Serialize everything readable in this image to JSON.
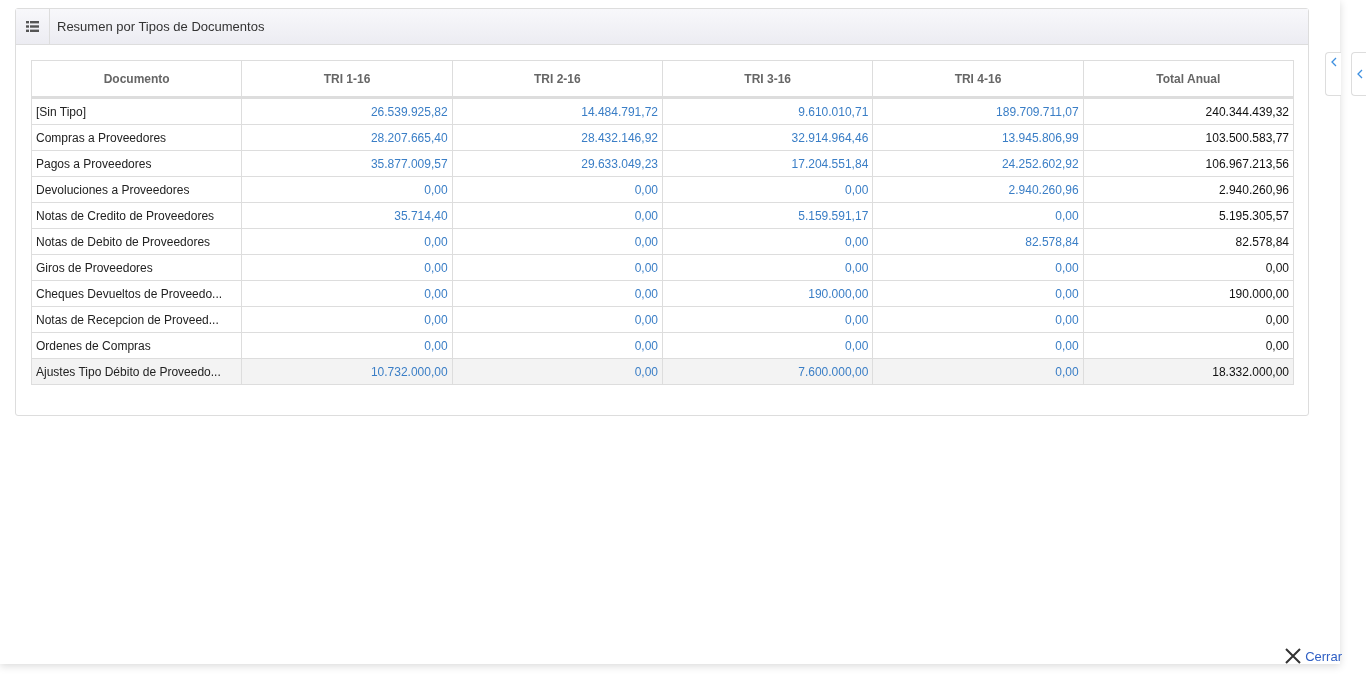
{
  "panel": {
    "title": "Resumen por Tipos de Documentos"
  },
  "table": {
    "columns": [
      "Documento",
      "TRI 1-16",
      "TRI 2-16",
      "TRI 3-16",
      "TRI 4-16",
      "Total Anual"
    ],
    "rows": [
      {
        "label": "[Sin Tipo]",
        "values": [
          "26.539.925,82",
          "14.484.791,72",
          "9.610.010,71",
          "189.709.711,07"
        ],
        "total": "240.344.439,32",
        "selected": false
      },
      {
        "label": "Compras a Proveedores",
        "values": [
          "28.207.665,40",
          "28.432.146,92",
          "32.914.964,46",
          "13.945.806,99"
        ],
        "total": "103.500.583,77",
        "selected": false
      },
      {
        "label": "Pagos a Proveedores",
        "values": [
          "35.877.009,57",
          "29.633.049,23",
          "17.204.551,84",
          "24.252.602,92"
        ],
        "total": "106.967.213,56",
        "selected": false
      },
      {
        "label": "Devoluciones a Proveedores",
        "values": [
          "0,00",
          "0,00",
          "0,00",
          "2.940.260,96"
        ],
        "total": "2.940.260,96",
        "selected": false
      },
      {
        "label": "Notas de Credito de Proveedores",
        "values": [
          "35.714,40",
          "0,00",
          "5.159.591,17",
          "0,00"
        ],
        "total": "5.195.305,57",
        "selected": false
      },
      {
        "label": "Notas de Debito de Proveedores",
        "values": [
          "0,00",
          "0,00",
          "0,00",
          "82.578,84"
        ],
        "total": "82.578,84",
        "selected": false
      },
      {
        "label": "Giros de Proveedores",
        "values": [
          "0,00",
          "0,00",
          "0,00",
          "0,00"
        ],
        "total": "0,00",
        "selected": false
      },
      {
        "label": "Cheques Devueltos de Proveedo...",
        "values": [
          "0,00",
          "0,00",
          "190.000,00",
          "0,00"
        ],
        "total": "190.000,00",
        "selected": false
      },
      {
        "label": "Notas de Recepcion de Proveed...",
        "values": [
          "0,00",
          "0,00",
          "0,00",
          "0,00"
        ],
        "total": "0,00",
        "selected": false
      },
      {
        "label": "Ordenes de Compras",
        "values": [
          "0,00",
          "0,00",
          "0,00",
          "0,00"
        ],
        "total": "0,00",
        "selected": false
      },
      {
        "label": "Ajustes Tipo Débito de Proveedo...",
        "values": [
          "10.732.000,00",
          "0,00",
          "7.600.000,00",
          "0,00"
        ],
        "total": "18.332.000,00",
        "selected": true
      }
    ]
  },
  "close_button": {
    "label": "Cerrar"
  }
}
